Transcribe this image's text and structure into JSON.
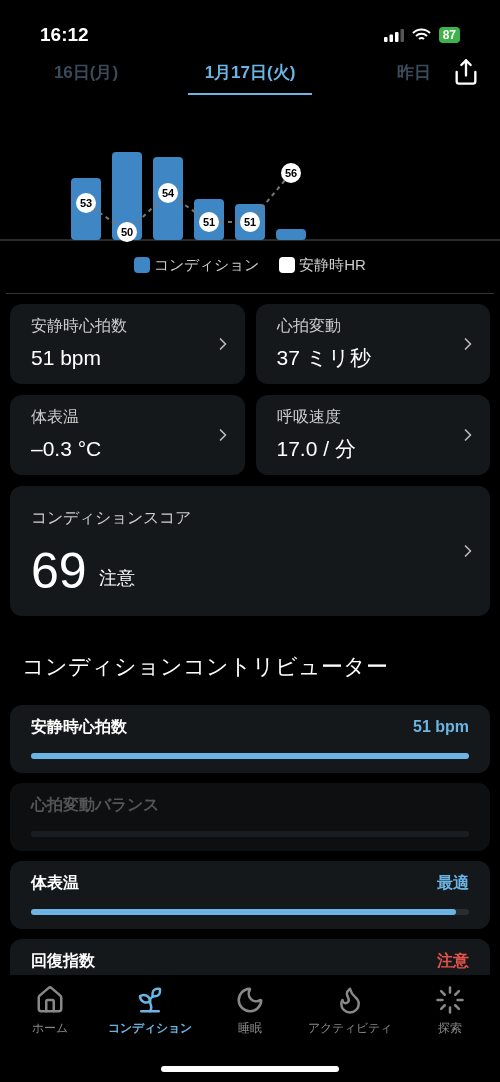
{
  "status_bar": {
    "time": "16:12",
    "battery": "87"
  },
  "date_tabs": [
    {
      "label": "16日(月)",
      "selected": false
    },
    {
      "label": "1月17日(火)",
      "selected": true
    },
    {
      "label": "昨日",
      "selected": false
    }
  ],
  "chart": {
    "hr_labels": [
      "53",
      "50",
      "54",
      "51",
      "51",
      "56"
    ],
    "legend": [
      {
        "label": "コンディション",
        "color": "#3f86c4"
      },
      {
        "label": "安静時HR",
        "color": "#ffffff"
      }
    ]
  },
  "metrics": [
    {
      "label": "安静時心拍数",
      "value": "51 bpm"
    },
    {
      "label": "心拍変動",
      "value": "37 ミリ秒"
    },
    {
      "label": "体表温",
      "value": "–0.3 °C"
    },
    {
      "label": "呼吸速度",
      "value": "17.0 / 分"
    }
  ],
  "score": {
    "label": "コンディションスコア",
    "value": "69",
    "status": "注意"
  },
  "contributors_title": "コンディションコントリビューター",
  "contributors": [
    {
      "label": "安静時心拍数",
      "value": "51 bpm",
      "color": "#6cb4e4",
      "level": 1,
      "disabled": false
    },
    {
      "label": "心拍変動バランス",
      "disabled": true
    },
    {
      "label": "体表温",
      "value": "最適",
      "color": "#6cb4e4",
      "level": 0.97,
      "disabled": false
    },
    {
      "label": "回復指数",
      "value": "注意",
      "color": "#e0534a",
      "disabled": false
    }
  ],
  "nav": [
    {
      "label": "ホーム",
      "kind": "home",
      "selected": false
    },
    {
      "label": "コンディション",
      "kind": "sprout",
      "selected": true
    },
    {
      "label": "睡眠",
      "kind": "moon",
      "selected": false
    },
    {
      "label": "アクティビティ",
      "kind": "flame",
      "selected": false
    },
    {
      "label": "探索",
      "kind": "burst",
      "selected": false
    }
  ]
}
